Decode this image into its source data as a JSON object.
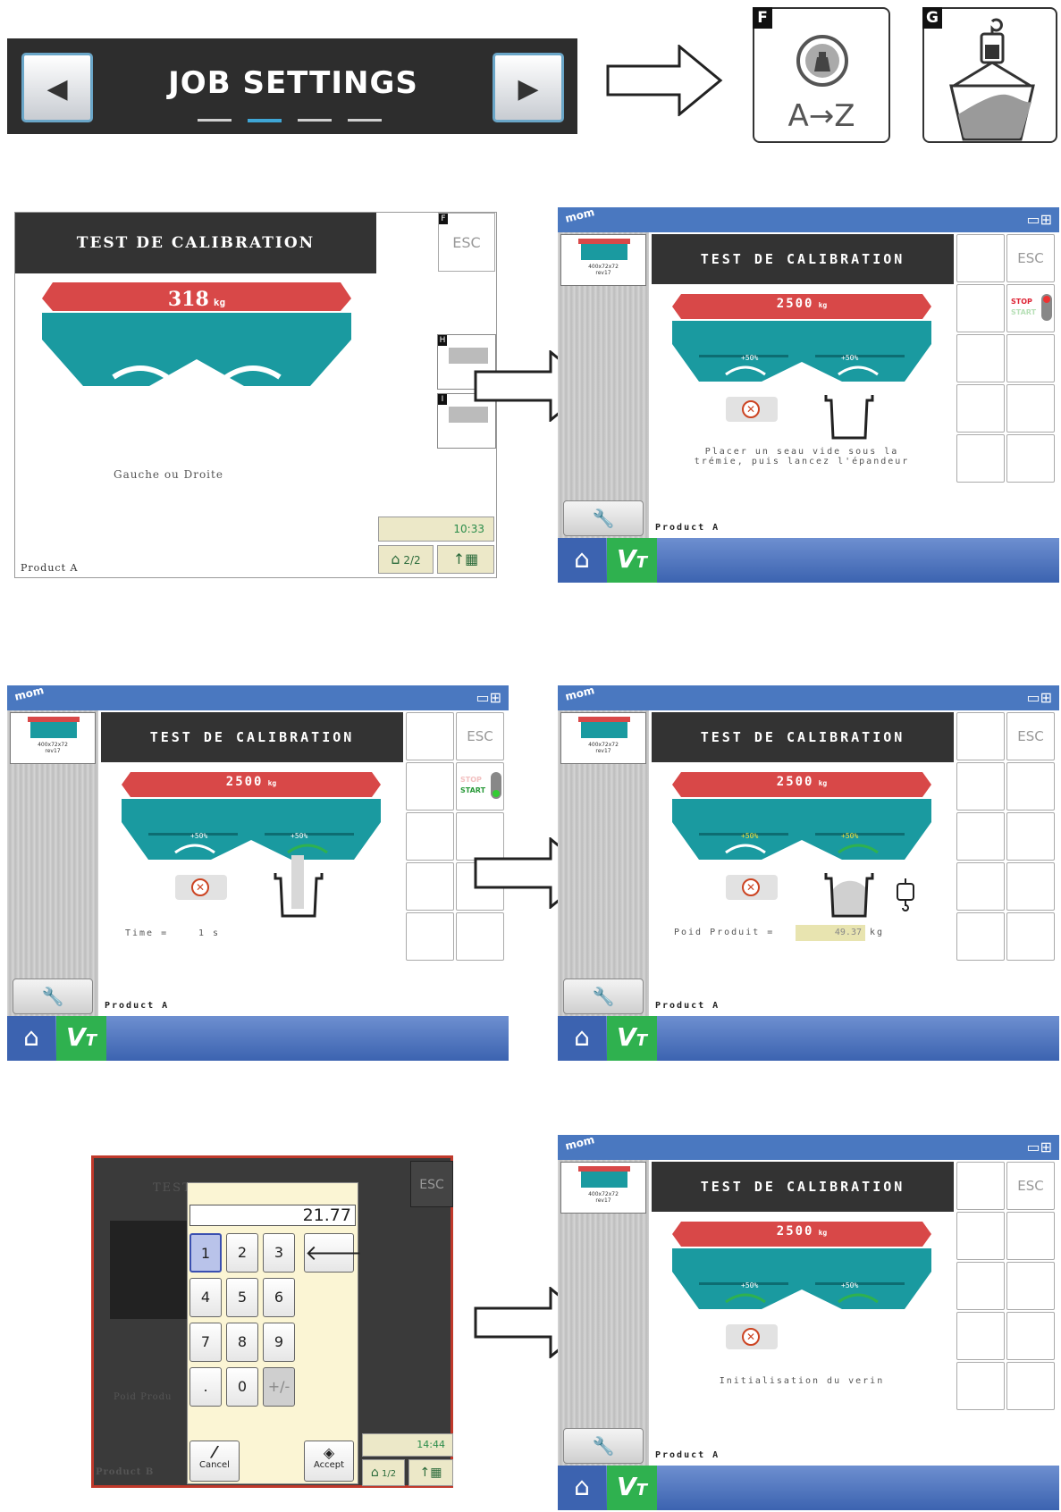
{
  "job_settings": {
    "title": "JOB SETTINGS",
    "left_arrow": "◀",
    "right_arrow": "▶"
  },
  "tiles": {
    "f": {
      "letter": "F",
      "text": "A→Z"
    },
    "g": {
      "letter": "G"
    }
  },
  "old_terminal": {
    "header": "TEST DE CALIBRATION",
    "weight": "318",
    "weight_unit": "kg",
    "esc": "ESC",
    "esc_letter": "F",
    "side_letters": [
      "H",
      "I"
    ],
    "message": "Gauche ou Droite",
    "time": "10:33",
    "page": "2/2",
    "product": "Product A"
  },
  "terminals": [
    {
      "header": "TEST DE CALIBRATION",
      "weight": "2500",
      "unit": "kg",
      "pct_left": "+50%",
      "pct_right": "+50%",
      "esc": "ESC",
      "toggle_top": "STOP",
      "toggle_bottom": "START",
      "message": "Placer un seau vide sous la\ntrémie, puis lancez l'épandeur",
      "product": "Product A",
      "thumb_caption": "400x72x72\nrev17",
      "brand": "mom"
    },
    {
      "header": "TEST DE CALIBRATION",
      "weight": "2500",
      "unit": "kg",
      "pct_left": "+50%",
      "pct_right": "+50%",
      "esc": "ESC",
      "toggle_top": "STOP",
      "toggle_bottom": "START",
      "time_label": "Time =",
      "time_value": "1 s",
      "product": "Product A",
      "thumb_caption": "400x72x72\nrev17",
      "brand": "mom"
    },
    {
      "header": "TEST DE CALIBRATION",
      "weight": "2500",
      "unit": "kg",
      "pct_left": "+50%",
      "pct_right": "+50%",
      "esc": "ESC",
      "poid_label": "Poid Produit =",
      "poid_value": "49.37",
      "poid_unit": "kg",
      "product": "Product A",
      "thumb_caption": "400x72x72\nrev17",
      "brand": "mom"
    },
    {
      "header": "TEST DE CALIBRATION",
      "weight": "2500",
      "unit": "kg",
      "pct_left": "+50%",
      "pct_right": "+50%",
      "esc": "ESC",
      "message": "Initialisation du verin",
      "product": "Product A",
      "thumb_caption": "400x72x72\nrev17",
      "brand": "mom"
    }
  ],
  "keypad": {
    "value": "21.77",
    "keys": [
      "1",
      "2",
      "3",
      "4",
      "5",
      "6",
      "7",
      "8",
      "9",
      ".",
      "0",
      "+/-"
    ],
    "backspace": "🡐",
    "cancel": "Cancel",
    "accept": "Accept",
    "esc": "ESC",
    "time": "14:44",
    "page": "1/2",
    "bg_title": "TEST",
    "bg_label": "Poid Produ",
    "product": "Product B"
  }
}
